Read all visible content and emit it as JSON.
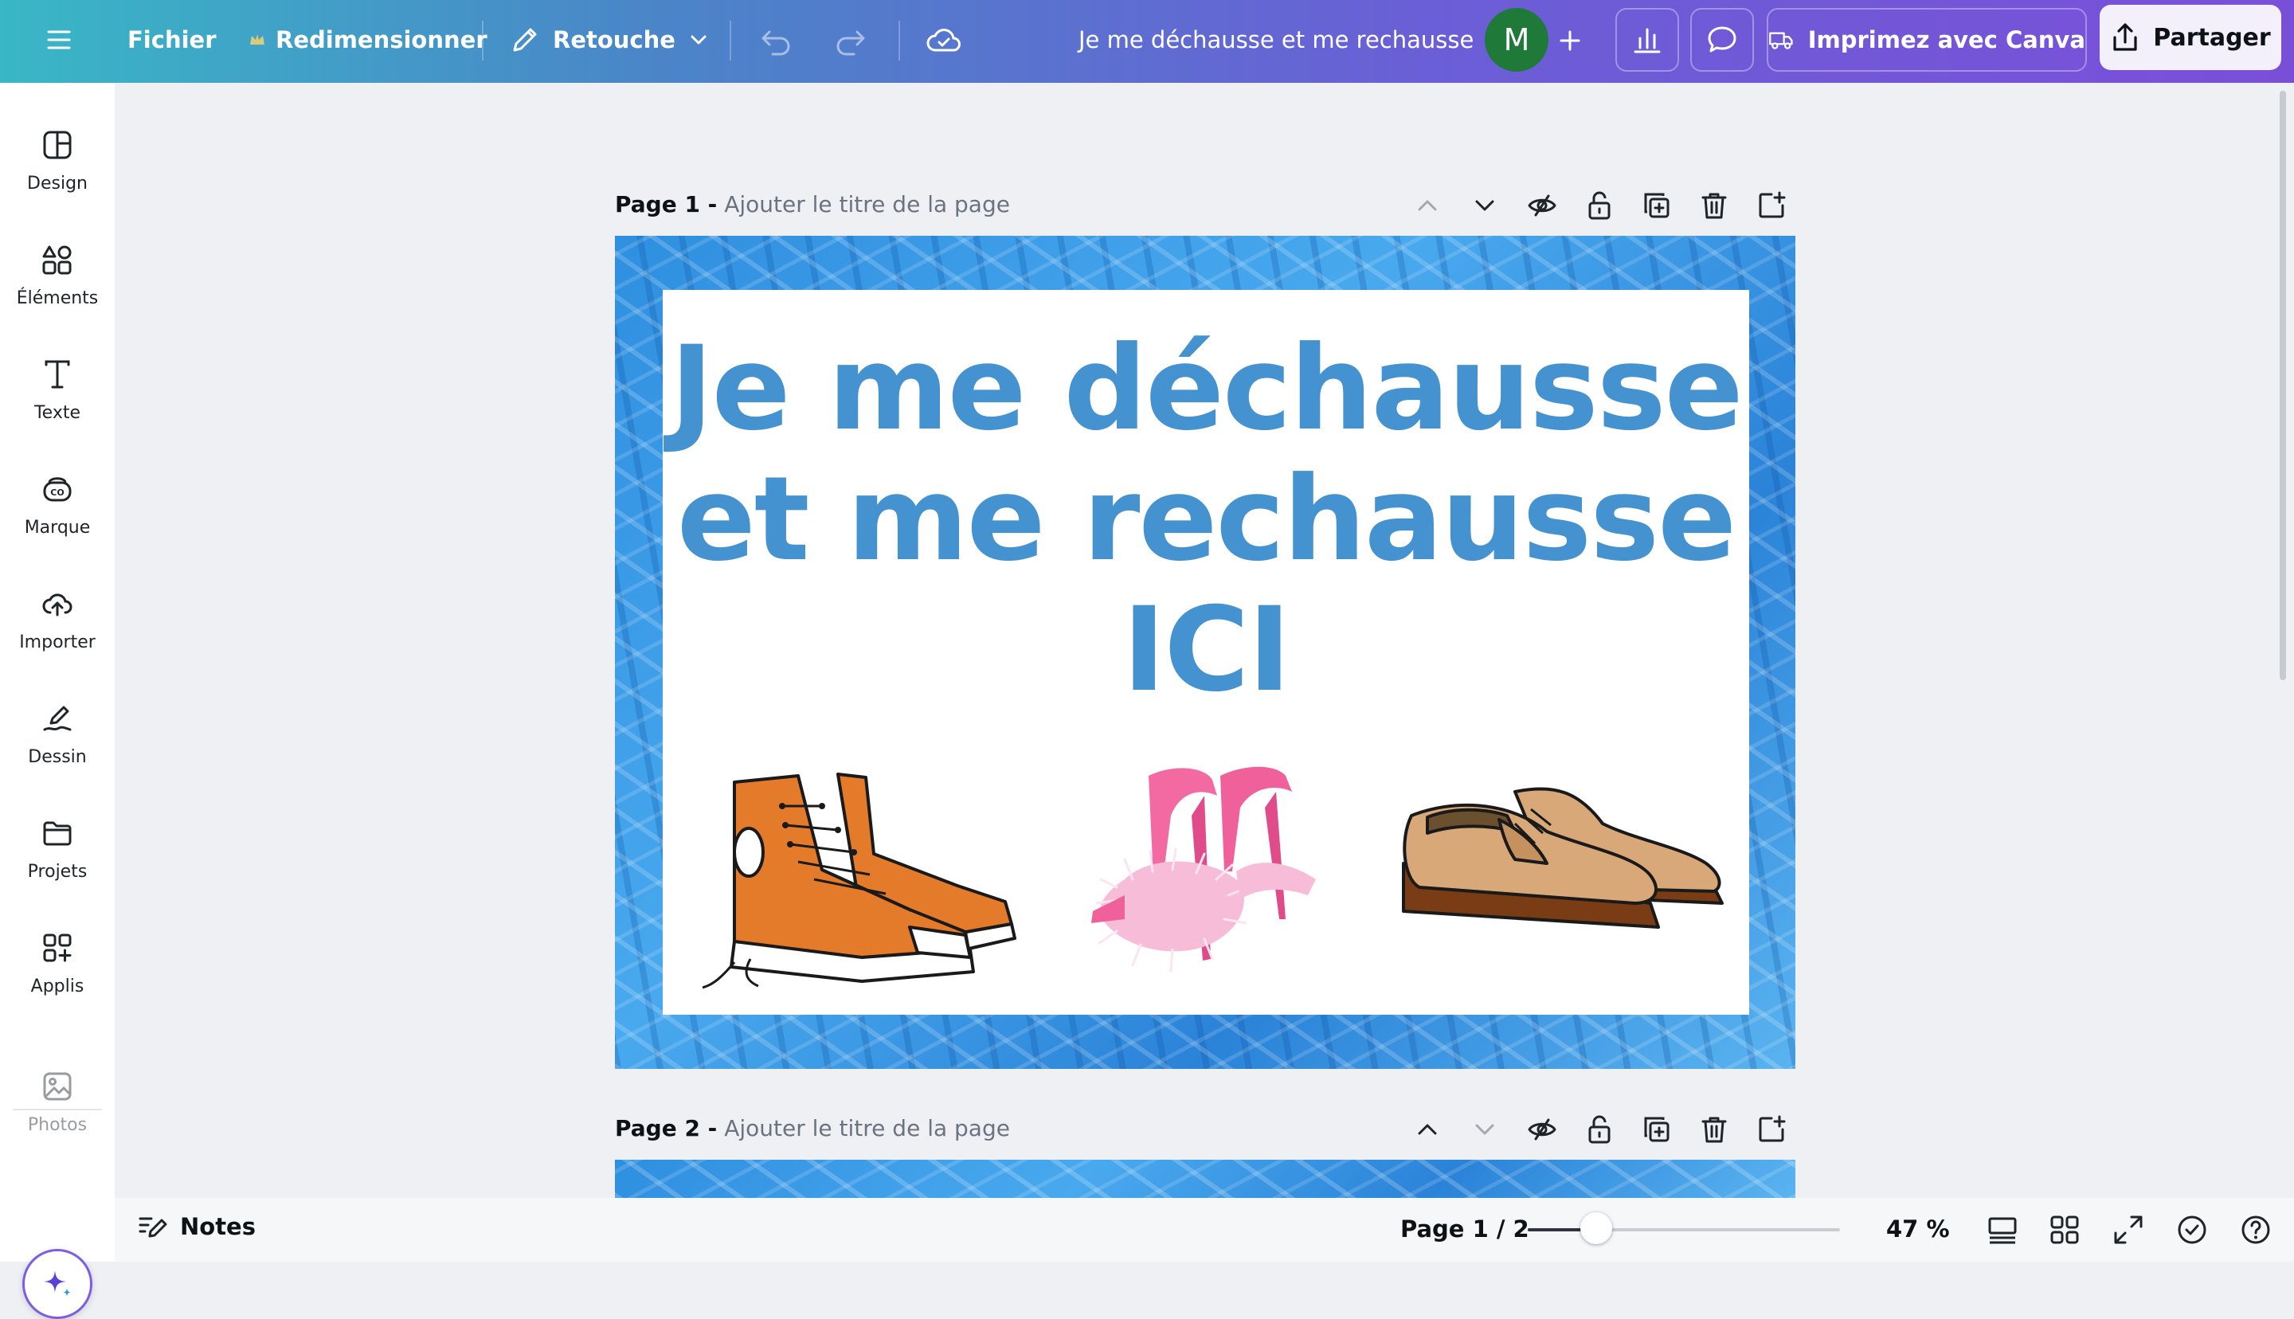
{
  "topbar": {
    "menu_label": "Fichier",
    "resize_label": "Redimensionner",
    "edit_label": "Retouche",
    "doc_title": "Je me déchausse et me rechausse",
    "avatar_initial": "M",
    "print_label": "Imprimez avec Canva",
    "share_label": "Partager"
  },
  "sidebar": {
    "items": [
      {
        "label": "Design",
        "icon": "layout-icon"
      },
      {
        "label": "Éléments",
        "icon": "shapes-icon"
      },
      {
        "label": "Texte",
        "icon": "text-icon"
      },
      {
        "label": "Marque",
        "icon": "brand-icon"
      },
      {
        "label": "Importer",
        "icon": "upload-cloud-icon"
      },
      {
        "label": "Dessin",
        "icon": "draw-icon"
      },
      {
        "label": "Projets",
        "icon": "folder-icon"
      },
      {
        "label": "Applis",
        "icon": "apps-icon"
      },
      {
        "label": "Photos",
        "icon": "image-icon"
      }
    ]
  },
  "pages": [
    {
      "label": "Page 1 -",
      "title_placeholder": "Ajouter le titre de la page"
    },
    {
      "label": "Page 2 -",
      "title_placeholder": "Ajouter le titre de la page"
    }
  ],
  "design": {
    "headline": "Je me déchausse et me rechausse ICI",
    "text_color": "#4592d1"
  },
  "bottombar": {
    "notes_label": "Notes",
    "page_indicator": "Page 1 / 2",
    "zoom_label": "47 %",
    "zoom_fraction": 0.22
  },
  "colors": {
    "accent": "#7d2ae8",
    "avatar_bg": "#1f7a3a"
  }
}
